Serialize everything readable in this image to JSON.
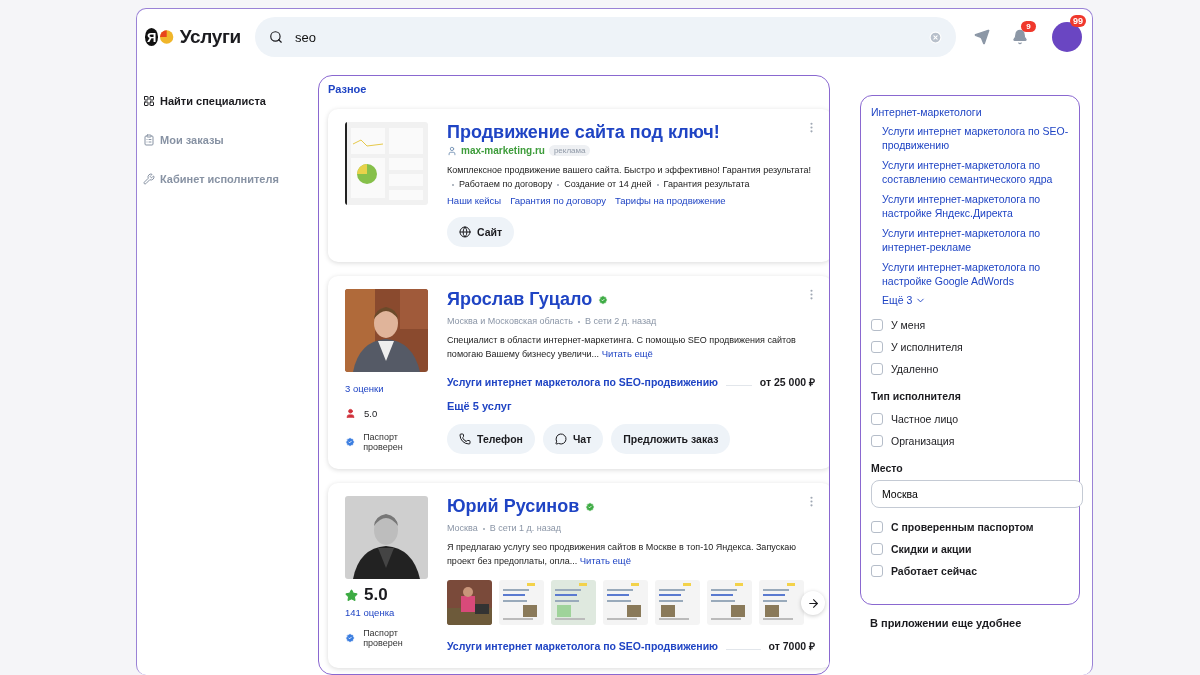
{
  "header": {
    "logo_letter": "Я",
    "logo_text": "Услуги",
    "search": {
      "value": "seo"
    },
    "notifications_badge": "9",
    "avatar_badge": "99"
  },
  "nav": [
    {
      "label": "Найти специалиста",
      "selected": true,
      "kind": "grid"
    },
    {
      "label": "Мои заказы",
      "selected": false,
      "kind": "orders"
    },
    {
      "label": "Кабинет исполнителя",
      "selected": false,
      "kind": "wrench"
    }
  ],
  "results": {
    "section_title": "Разное",
    "ad": {
      "title": "Продвижение сайта под ключ!",
      "domain": "max-marketing.ru",
      "badge": "реклама",
      "description": "Комплексное продвижение вашего сайта. Быстро и эффективно! Гарантия результата!",
      "features": [
        "Работаем по договору",
        "Создание от 14 дней",
        "Гарантия результата"
      ],
      "links": [
        "Наши кейсы",
        "Гарантия по договору",
        "Тарифы на продвижение"
      ],
      "button": "Сайт"
    },
    "specialists": [
      {
        "name": "Ярослав Гуцало",
        "verified": true,
        "location": "Москва и Московская область",
        "online": "В сети 2 д. назад",
        "about": "Специалист в области интернет-маркетинга. С помощью SEO продвижения сайтов помогаю Вашему бизнесу увеличи...",
        "read_more": "Читать ещё",
        "kind": "compact",
        "reviews": "3 оценки",
        "rating": "5.0",
        "passport": "Паспорт проверен",
        "service": "Услуги интернет маркетолога по SEO-продвижению",
        "price": "от 25 000 ₽",
        "more_services": "Ещё 5 услуг",
        "actions": [
          {
            "label": "Телефон",
            "kind": "phone"
          },
          {
            "label": "Чат",
            "kind": "chat"
          },
          {
            "label": "Предложить заказ",
            "kind": "plain"
          }
        ]
      },
      {
        "name": "Юрий Русинов",
        "verified": true,
        "location": "Москва",
        "online": "В сети 1 д. назад",
        "about": "Я предлагаю услугу seo продвижения сайтов в Москве в топ-10 Яндекса. Запускаю проект без предоплаты, опла...",
        "read_more": "Читать ещё",
        "kind": "large",
        "reviews": "141 оценка",
        "rating": "5.0",
        "passport": "Паспорт проверен",
        "service": "Услуги интернет маркетолога по SEO-продвижению",
        "price": "от 7000 ₽"
      }
    ]
  },
  "filters": {
    "category": "Интернет-маркетологи",
    "subcategories": [
      "Услуги интернет маркетолога по SEO-продвижению",
      "Услуги интернет-маркетолога по составлению семантического ядра",
      "Услуги интернет-маркетолога по настройке Яндекс.Директа",
      "Услуги интернет-маркетолога по интернет-рекламе",
      "Услуги интернет-маркетолога по настройке Google AdWords"
    ],
    "more": "Ещё 3",
    "sections": [
      {
        "kind": "checkboxes",
        "options": [
          {
            "label": "У меня",
            "checked": false
          },
          {
            "label": "У исполнителя",
            "checked": false
          },
          {
            "label": "Удаленно",
            "checked": false
          }
        ]
      },
      {
        "kind": "checkboxes",
        "heading": "Тип исполнителя",
        "options": [
          {
            "label": "Частное лицо",
            "checked": false
          },
          {
            "label": "Организация",
            "checked": false
          }
        ]
      },
      {
        "kind": "field",
        "heading": "Место",
        "value": "Москва"
      },
      {
        "kind": "strong_checkboxes",
        "options": [
          {
            "label": "С проверенным паспортом",
            "checked": false
          },
          {
            "label": "Скидки и акции",
            "checked": false
          },
          {
            "label": "Работает сейчас",
            "checked": false
          }
        ]
      }
    ]
  },
  "app_promo": "В приложении еще удобнее"
}
